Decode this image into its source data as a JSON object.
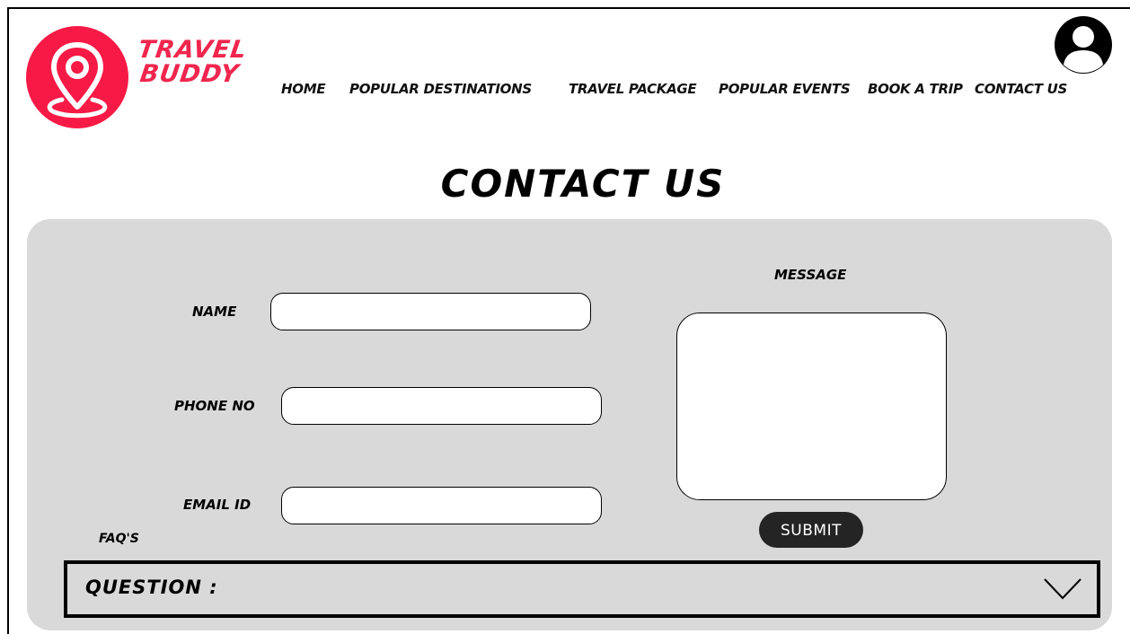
{
  "brand": {
    "line1": "TRAVEL",
    "line2": "BUDDY",
    "accent": "#f81a46"
  },
  "nav": {
    "items": [
      {
        "label": "HOME"
      },
      {
        "label": "POPULAR DESTINATIONS"
      },
      {
        "label": "TRAVEL PACKAGE"
      },
      {
        "label": "POPULAR EVENTS"
      },
      {
        "label": "BOOK A TRIP"
      },
      {
        "label": "CONTACT US"
      }
    ]
  },
  "icons": {
    "logo": "map-pin-icon",
    "avatar": "user-account-icon",
    "faq_toggle": "chevron-down-icon"
  },
  "page": {
    "title": "CONTACT US"
  },
  "form": {
    "name_label": "NAME",
    "phone_label": "PHONE NO",
    "email_label": "EMAIL ID",
    "message_label": "MESSAGE",
    "submit_label": "SUBMIT",
    "name_value": "",
    "phone_value": "",
    "email_value": "",
    "message_value": ""
  },
  "faq": {
    "heading": "FAQ'S",
    "question_label": "QUESTION :"
  },
  "colors": {
    "panel_bg": "#d9d9d9",
    "submit_bg": "#242424"
  }
}
